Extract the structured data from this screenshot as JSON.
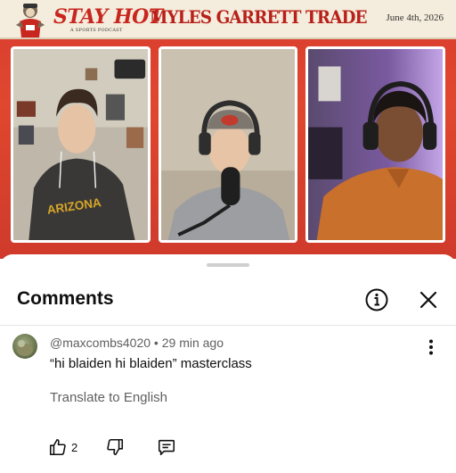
{
  "video": {
    "banner": {
      "brand": "STAY HOT",
      "brand_sub": "A SPORTS PODCAST",
      "headline": "MYLES GARRETT TRADE",
      "date": "June 4th, 2026"
    },
    "colors": {
      "background": "#d93b2e",
      "banner": "#f4ecdc",
      "brand": "#c8271f"
    }
  },
  "comments_sheet": {
    "title": "Comments",
    "icons": {
      "info": "info-icon",
      "close": "close-icon"
    },
    "comment": {
      "author": "@maxcombs4020",
      "separator": " • ",
      "time": "29 min ago",
      "text": "“hi blaiden hi blaiden” masterclass",
      "translate_label": "Translate to English",
      "likes": "2",
      "icons": {
        "like": "thumbs-up-icon",
        "dislike": "thumbs-down-icon",
        "reply": "reply-icon",
        "more": "more-vertical-icon"
      }
    }
  }
}
